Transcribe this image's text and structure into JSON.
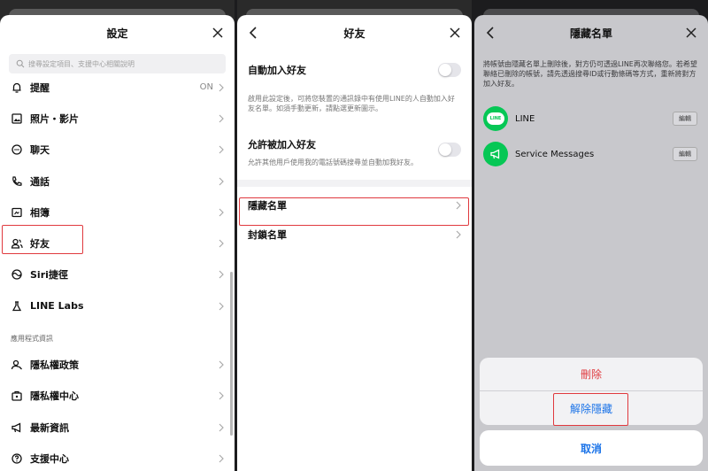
{
  "settings": {
    "title": "設定",
    "search_placeholder": "搜尋設定項目、支援中心相關說明",
    "items": [
      {
        "label": "提醒",
        "value": "ON"
      },
      {
        "label": "照片・影片"
      },
      {
        "label": "聊天"
      },
      {
        "label": "通話"
      },
      {
        "label": "相簿"
      },
      {
        "label": "好友"
      },
      {
        "label": "Siri捷徑"
      },
      {
        "label": "LINE Labs"
      }
    ],
    "section_label": "應用程式資訊",
    "info_items": [
      {
        "label": "隱私權政策"
      },
      {
        "label": "隱私權中心"
      },
      {
        "label": "最新資訊"
      },
      {
        "label": "支援中心"
      }
    ]
  },
  "friends": {
    "title": "好友",
    "auto_add": {
      "title": "自動加入好友",
      "desc": "啟用此設定後，可將您裝置的通訊錄中有使用LINE的人自動加入好友名單。如須手動更新，請點選更新圖示。"
    },
    "allow_add": {
      "title": "允許被加入好友",
      "desc": "允許其他用戶使用我的電話號碼搜尋並自動加我好友。"
    },
    "hidden_list": "隱藏名單",
    "blocked_list": "封鎖名單"
  },
  "hidden": {
    "title": "隱藏名單",
    "desc": "將帳號由隱藏名單上刪除後，對方仍可透過LINE再次聯絡您。若希望聯絡已刪除的帳號，請先透過搜尋ID或行動條碼等方式，重新將對方加入好友。",
    "accounts": [
      {
        "name": "LINE",
        "edit": "編輯",
        "avatar_text": "LINE"
      },
      {
        "name": "Service Messages",
        "edit": "編輯"
      }
    ],
    "actions": {
      "delete": "刪除",
      "unhide": "解除隱藏",
      "cancel": "取消"
    }
  },
  "colors": {
    "line_green": "#06c755",
    "highlight_red": "#e0393e",
    "ios_blue": "#1a73e8"
  }
}
